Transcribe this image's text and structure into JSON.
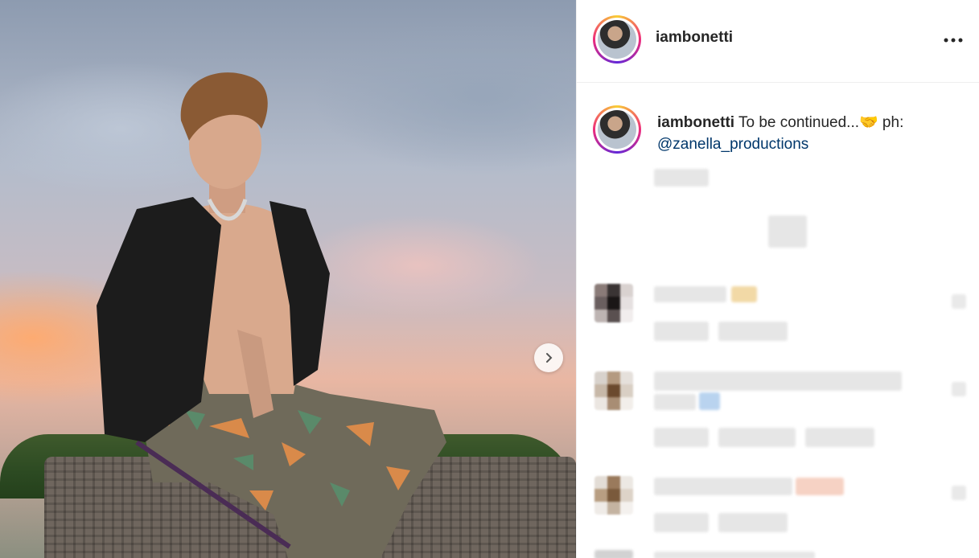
{
  "post": {
    "username": "iambonetti",
    "caption_text": "To be continued...🤝 ph:",
    "caption_mention": "@zanella_productions"
  },
  "colors": {
    "mention": "#00376b",
    "text": "#262626",
    "divider": "#efefef"
  },
  "icons": {
    "more": "more-horizontal-icon",
    "next": "chevron-right-icon"
  }
}
